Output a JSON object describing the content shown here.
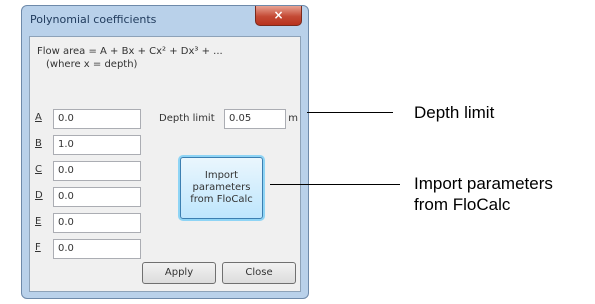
{
  "dialog": {
    "title": "Polynomial coefficients",
    "close_glyph": "×"
  },
  "formula": {
    "line1": "Flow area = A + Bx + Cx² + Dx³ + ...",
    "line2": "(where x = depth)"
  },
  "coefficients": [
    {
      "label": "A",
      "value": "0.0"
    },
    {
      "label": "B",
      "value": "1.0"
    },
    {
      "label": "C",
      "value": "0.0"
    },
    {
      "label": "D",
      "value": "0.0"
    },
    {
      "label": "E",
      "value": "0.0"
    },
    {
      "label": "F",
      "value": "0.0"
    }
  ],
  "depth_limit": {
    "label": "Depth limit",
    "value": "0.05",
    "unit": "m"
  },
  "import_button": {
    "label": "Import parameters from FloCalc"
  },
  "buttons": {
    "apply": "Apply",
    "close": "Close"
  },
  "callouts": {
    "depth_limit": "Depth limit",
    "import_line1": "Import parameters",
    "import_line2": "from FloCalc"
  }
}
